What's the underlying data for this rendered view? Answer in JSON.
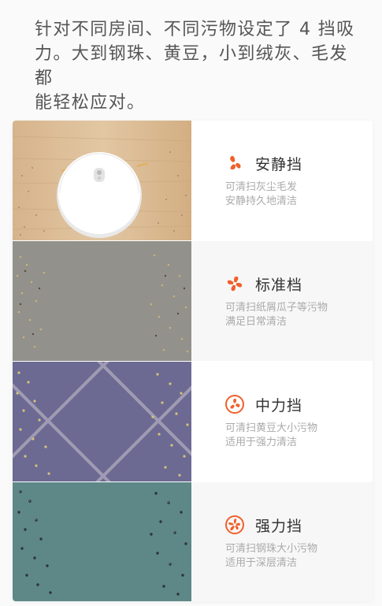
{
  "intro": {
    "line1": "针对不同房间、不同污物设定了 4 挡吸",
    "line2": "力。大到钢珠、黄豆，小到绒灰、毛发都",
    "line3": "能轻松应对。"
  },
  "accent_color": "#f0602a",
  "modes": [
    {
      "name": "安静挡",
      "icon": "fan-quiet-icon",
      "desc1": "可清扫灰尘毛发",
      "desc2": "安静持久地清洁",
      "surface": "wood-floor"
    },
    {
      "name": "标准档",
      "icon": "fan-standard-icon",
      "desc1": "可清扫纸屑瓜子等污物",
      "desc2": "满足日常清洁",
      "surface": "grey-tile"
    },
    {
      "name": "中力挡",
      "icon": "fan-medium-icon",
      "desc1": "可清扫黄豆大小污物",
      "desc2": "适用于强力清洁",
      "surface": "purple-carpet"
    },
    {
      "name": "强力挡",
      "icon": "fan-strong-icon",
      "desc1": "可清扫钢珠大小污物",
      "desc2": "适用于深层清洁",
      "surface": "teal-carpet"
    }
  ]
}
